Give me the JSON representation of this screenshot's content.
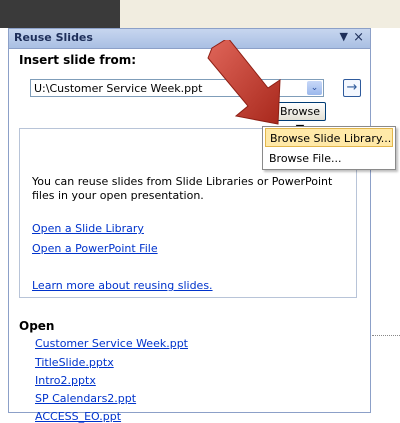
{
  "pane": {
    "title": "Reuse Slides",
    "menu_glyph": "▼",
    "close_glyph": "×",
    "insert_label": "Insert slide from:",
    "path_value": "U:\\Customer Service Week.ppt",
    "dropdown_glyph": "⌄",
    "go_glyph": "→",
    "browse_label": "Browse ▼"
  },
  "info": {
    "text": "You can reuse slides from Slide Libraries or PowerPoint files in your open presentation.",
    "link_library": "Open a Slide Library",
    "link_powerpoint": "Open a PowerPoint File",
    "link_learn": "Learn more about reusing slides."
  },
  "open_section": {
    "label": "Open",
    "files": [
      "Customer Service Week.ppt",
      "TitleSlide.pptx",
      "Intro2.pptx",
      "SP Calendars2.ppt",
      "ACCESS_EO.ppt"
    ]
  },
  "browse_menu": {
    "items": [
      "Browse Slide Library...",
      "Browse File..."
    ]
  },
  "colors": {
    "accent_link": "#0033cc",
    "header_blue": "#a9bfe3",
    "menu_highlight": "#ffe9a8",
    "arrow_red": "#c0392b"
  },
  "icons": {
    "arrow": "red-pointer-arrow"
  }
}
